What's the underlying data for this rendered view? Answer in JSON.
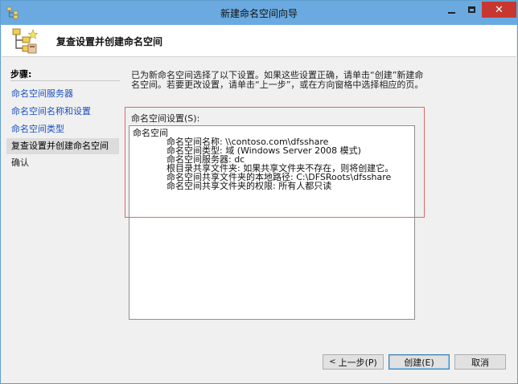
{
  "window": {
    "title": "新建命名空间向导"
  },
  "header": {
    "heading": "复查设置并创建命名空间"
  },
  "sidebar": {
    "title": "步骤:",
    "items": [
      {
        "label": "命名空间服务器",
        "state": "link"
      },
      {
        "label": "命名空间名称和设置",
        "state": "link"
      },
      {
        "label": "命名空间类型",
        "state": "link"
      },
      {
        "label": "复查设置并创建命名空间",
        "state": "current"
      },
      {
        "label": "确认",
        "state": "plain"
      }
    ]
  },
  "main": {
    "intro": "已为新命名空间选择了以下设置。如果这些设置正确，请单击“创建”新建命名空间。若要更改设置，请单击“上一步”，或在方向窗格中选择相应的页。",
    "settings_label": "命名空间设置(S):",
    "settings": {
      "heading": "命名空间",
      "lines": [
        "命名空间名称: \\\\contoso.com\\dfsshare",
        "命名空间类型: 域 (Windows Server 2008 模式)",
        "命名空间服务器: dc",
        "根目录共享文件夹: 如果共享文件夹不存在，则将创建它。",
        "命名空间共享文件夹的本地路径: C:\\DFSRoots\\dfsshare",
        "命名空间共享文件夹的权限: 所有人都只读"
      ]
    }
  },
  "footer": {
    "back_label": "上一步(P)",
    "back_arrow": "<",
    "create_label": "创建(E)",
    "cancel_label": "取消"
  },
  "colors": {
    "titlebar": "#6aaae0",
    "close_button": "#c7372f",
    "link": "#1b4fbf",
    "highlight_frame": "#d96a6a"
  },
  "icons": {
    "app": "namespace-tree-icon",
    "wizard": "namespace-wizard-icon"
  }
}
